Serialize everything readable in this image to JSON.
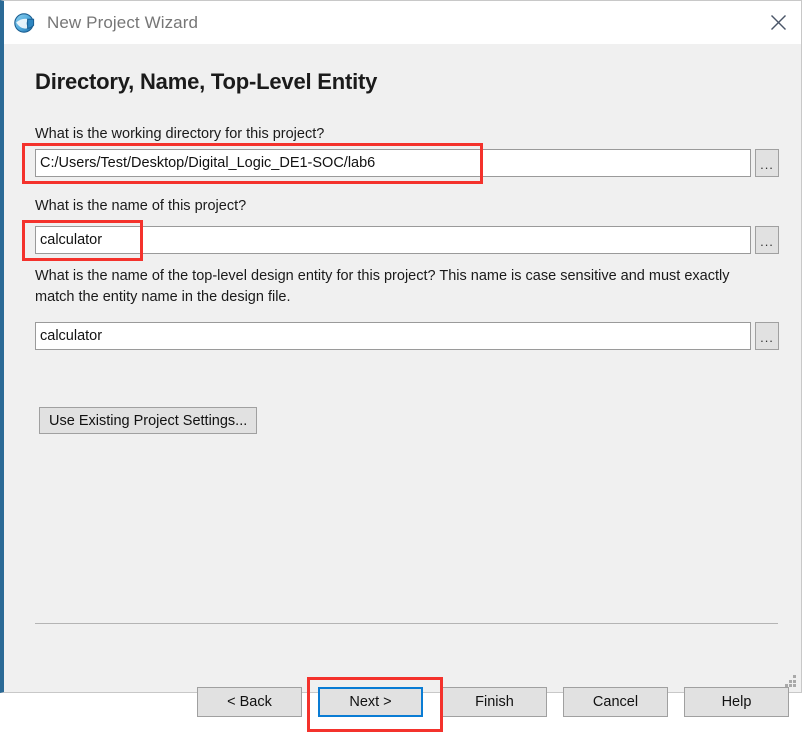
{
  "window": {
    "title": "New Project Wizard",
    "icon": "quartus-globe-icon",
    "close_icon": "close-icon",
    "accent_color": "#2b6a96",
    "background": "#f0f0f0"
  },
  "page": {
    "heading": "Directory, Name, Top-Level Entity"
  },
  "fields": {
    "directory": {
      "label": "What is the working directory for this project?",
      "value": "C:/Users/Test/Desktop/Digital_Logic_DE1-SOC/lab6",
      "browse_label": "...",
      "highlighted": true
    },
    "project_name": {
      "label": "What is the name of this project?",
      "value": "calculator",
      "browse_label": "...",
      "highlighted": true
    },
    "top_level_entity": {
      "label": "What is the name of the top-level design entity for this project? This name is case sensitive and must exactly match the entity name in the design file.",
      "value": "calculator",
      "browse_label": "...",
      "highlighted": false
    }
  },
  "buttons": {
    "use_existing": "Use Existing Project Settings...",
    "back": "< Back",
    "next": "Next >",
    "finish": "Finish",
    "cancel": "Cancel",
    "help": "Help"
  },
  "annotations": {
    "color": "#f4322c",
    "targets": [
      "directory-input",
      "project-name-input",
      "next-button"
    ]
  },
  "focus": {
    "element": "next-button",
    "color": "#0a7cd4"
  }
}
